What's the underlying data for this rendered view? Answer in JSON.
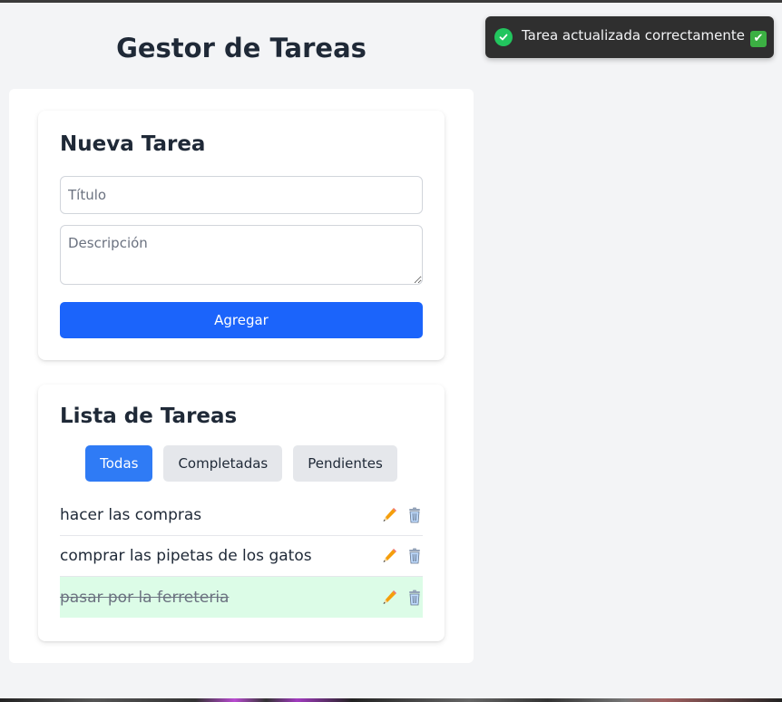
{
  "app": {
    "title": "Gestor de Tareas"
  },
  "new_task": {
    "heading": "Nueva Tarea",
    "title_placeholder": "Título",
    "description_placeholder": "Descripción",
    "add_label": "Agregar"
  },
  "task_list": {
    "heading": "Lista de Tareas",
    "filters": [
      {
        "label": "Todas",
        "active": true
      },
      {
        "label": "Completadas",
        "active": false
      },
      {
        "label": "Pendientes",
        "active": false
      }
    ],
    "tasks": [
      {
        "text": "hacer las compras",
        "completed": false
      },
      {
        "text": "comprar las pipetas de los gatos",
        "completed": false
      },
      {
        "text": "pasar por la ferreteria",
        "completed": true
      }
    ],
    "icons": {
      "edit": "pencil-icon",
      "delete": "trash-icon"
    }
  },
  "toast": {
    "message": "Tarea actualizada correctamente",
    "emoji": "✔",
    "status_icon": "check-circle-icon"
  },
  "colors": {
    "primary": "#1b64fb",
    "active_filter": "#2f7bf5",
    "completed_row": "#dcfce7",
    "toast_bg": "#2f2f2f",
    "success": "#22c55e"
  }
}
